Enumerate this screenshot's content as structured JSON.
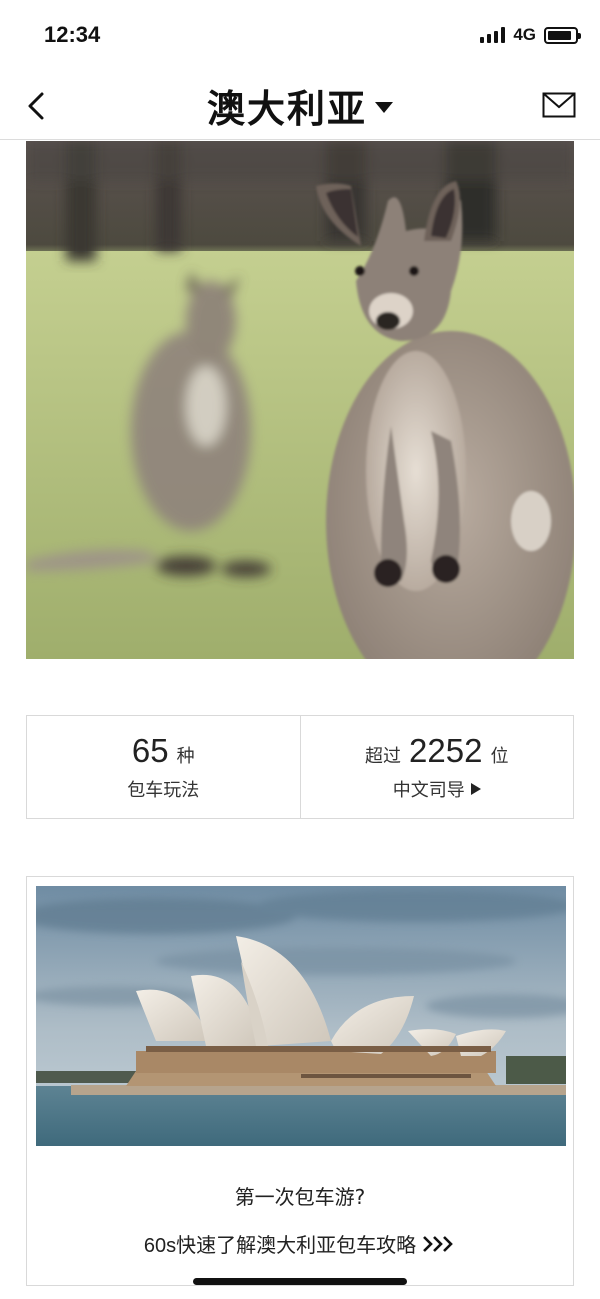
{
  "status_bar": {
    "time": "12:34",
    "network": "4G",
    "signal_bars": 4,
    "battery_level": 0.9
  },
  "nav": {
    "title": "澳大利亚",
    "back_icon": "chevron-left-icon",
    "dropdown_icon": "caret-down-icon",
    "message_icon": "mail-icon"
  },
  "hero": {
    "image": "kangaroo-photo"
  },
  "stats": {
    "left": {
      "number": "65",
      "unit": "种",
      "label": "包车玩法"
    },
    "right": {
      "prefix": "超过",
      "number": "2252",
      "unit": "位",
      "label": "中文司导"
    }
  },
  "card": {
    "image": "sydney-opera-house-photo",
    "question": "第一次包车游?",
    "link_number": "60s",
    "link_text": "快速了解澳大利亚包车攻略",
    "link_icon": "triple-chevron-right-icon"
  }
}
